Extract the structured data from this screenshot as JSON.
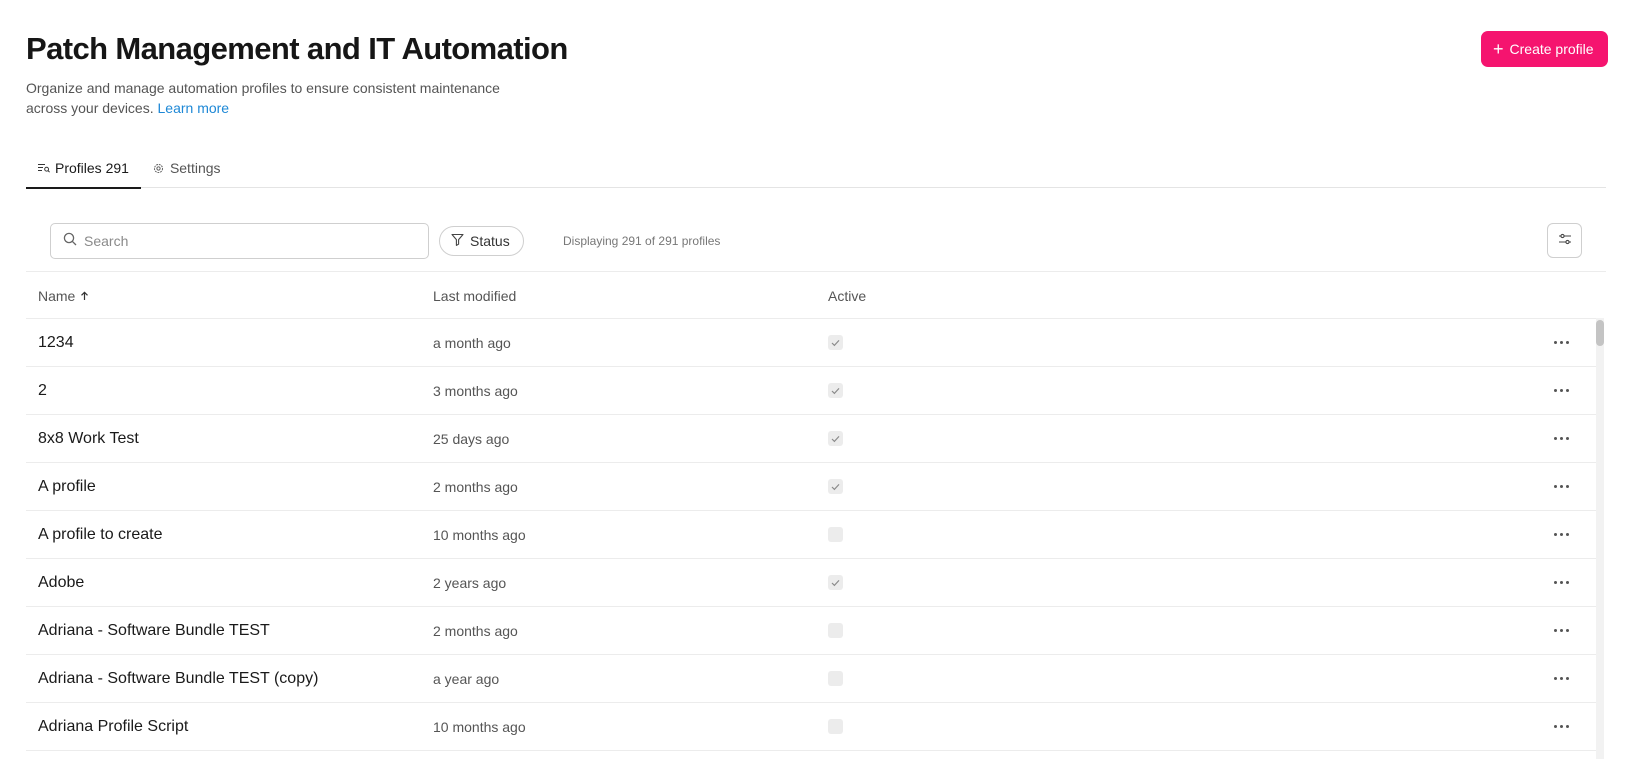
{
  "header": {
    "title": "Patch Management and IT Automation",
    "subtitle": "Organize and manage automation profiles to ensure consistent maintenance across your devices.",
    "learn_more": "Learn more",
    "create_button": "Create profile"
  },
  "tabs": [
    {
      "label": "Profiles 291",
      "icon": "list-icon",
      "active": true
    },
    {
      "label": "Settings",
      "icon": "gear-icon",
      "active": false
    }
  ],
  "toolbar": {
    "search_placeholder": "Search",
    "status_filter": "Status",
    "count_text": "Displaying 291 of 291 profiles"
  },
  "table": {
    "columns": {
      "name": "Name",
      "last_modified": "Last modified",
      "active": "Active"
    },
    "sort": {
      "column": "name",
      "direction": "ascending"
    },
    "rows": [
      {
        "name": "1234",
        "last_modified": "a month ago",
        "active": true
      },
      {
        "name": "2",
        "last_modified": "3 months ago",
        "active": true
      },
      {
        "name": "8x8 Work Test",
        "last_modified": "25 days ago",
        "active": true
      },
      {
        "name": "A profile",
        "last_modified": "2 months ago",
        "active": true
      },
      {
        "name": "A profile to create",
        "last_modified": "10 months ago",
        "active": false
      },
      {
        "name": "Adobe",
        "last_modified": "2 years ago",
        "active": true
      },
      {
        "name": "Adriana - Software Bundle TEST",
        "last_modified": "2 months ago",
        "active": false
      },
      {
        "name": "Adriana - Software Bundle TEST (copy)",
        "last_modified": "a year ago",
        "active": false
      },
      {
        "name": "Adriana Profile Script",
        "last_modified": "10 months ago",
        "active": false
      }
    ]
  },
  "colors": {
    "accent": "#f5146f",
    "link": "#1e88d6"
  }
}
